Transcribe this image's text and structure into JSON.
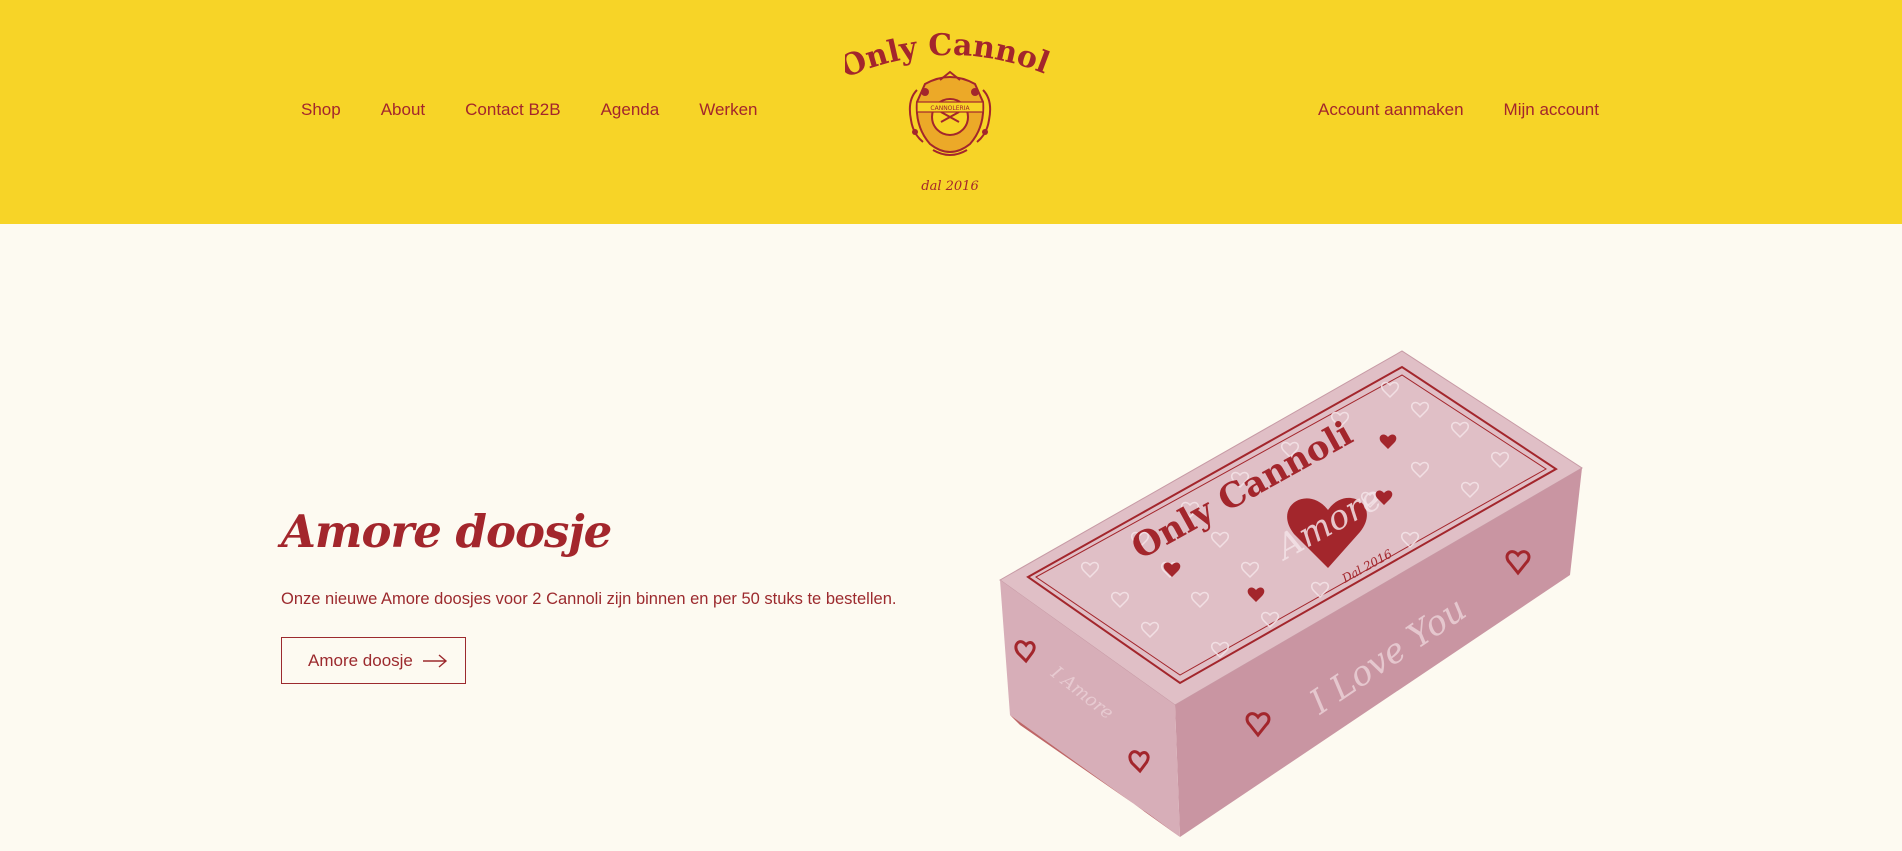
{
  "header": {
    "nav_left": [
      {
        "label": "Shop"
      },
      {
        "label": "About"
      },
      {
        "label": "Contact B2B"
      },
      {
        "label": "Agenda"
      },
      {
        "label": "Werken"
      }
    ],
    "nav_right": [
      {
        "label": "Account aanmaken"
      },
      {
        "label": "Mijn account"
      }
    ],
    "logo": {
      "wordmark": "Only Cannoli",
      "crest_banner": "CANNOLERIA",
      "tagline": "dal 2016"
    }
  },
  "hero": {
    "title": "Amore doosje",
    "text": "Onze nieuwe Amore doosjes voor 2 Cannoli zijn binnen en per 50 stuks te bestellen.",
    "button_label": "Amore doosje",
    "button_icon": "arrow-right-icon"
  },
  "product_image": {
    "alt": "Only Cannoli Amore box",
    "box_brand": "Only Cannoli",
    "box_heart_text": "Amore",
    "box_dal": "Dal 2016",
    "box_side_text": "I Love You",
    "box_end_text": "I Amore"
  },
  "colors": {
    "header_bg": "#f7d427",
    "page_bg": "#fdfaf1",
    "brand_red": "#a3262c",
    "box_pink": "#e0bfc6"
  }
}
